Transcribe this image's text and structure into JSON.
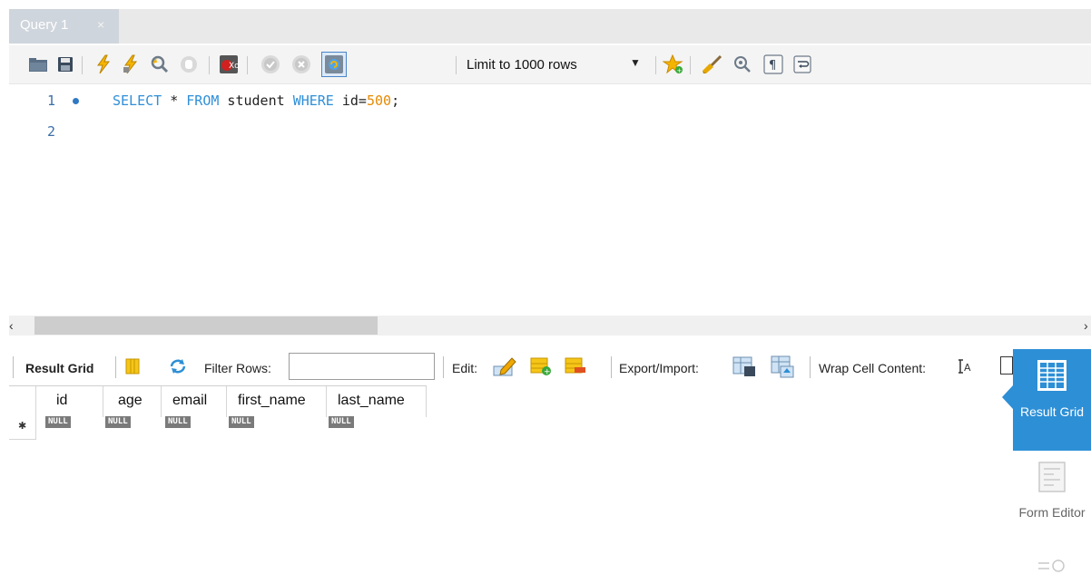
{
  "tab": {
    "title": "Query 1",
    "close_glyph": "×"
  },
  "toolbar": {
    "icons": [
      "open-folder-icon",
      "save-icon",
      "execute-icon",
      "execute-current-icon",
      "explain-icon",
      "stop-icon",
      "toggle-error-icon",
      "commit-icon",
      "rollback-icon",
      "autocommit-icon",
      "bookmark-icon",
      "beautify-icon",
      "find-icon",
      "invisible-chars-icon",
      "wrap-icon"
    ],
    "limit_label": "Limit to 1000 rows"
  },
  "editor": {
    "lines": [
      {
        "number": "1",
        "has_dot": true
      },
      {
        "number": "2",
        "has_dot": false
      }
    ],
    "code": {
      "kw1": "SELECT",
      "t1": " * ",
      "kw2": "FROM",
      "t2": " student ",
      "kw3": "WHERE",
      "t3": " id=",
      "num": "500",
      "t4": ";"
    }
  },
  "scroll": {
    "left_arrow": "‹",
    "right_arrow": "›"
  },
  "result_toolbar": {
    "result_grid": "Result Grid",
    "filter_rows": "Filter Rows:",
    "edit": "Edit:",
    "export_import": "Export/Import:",
    "wrap_cell": "Wrap Cell Content:"
  },
  "grid": {
    "columns": [
      "id",
      "age",
      "email",
      "first_name",
      "last_name"
    ],
    "row": [
      "NULL",
      "NULL",
      "NULL",
      "NULL",
      "NULL"
    ]
  },
  "side_panel": {
    "result_grid_label": "Result Grid",
    "form_editor_label": "Form Editor"
  },
  "colors": {
    "accent": "#2d8fd6",
    "keyword": "#2f8fd8",
    "number": "#e68a00"
  }
}
